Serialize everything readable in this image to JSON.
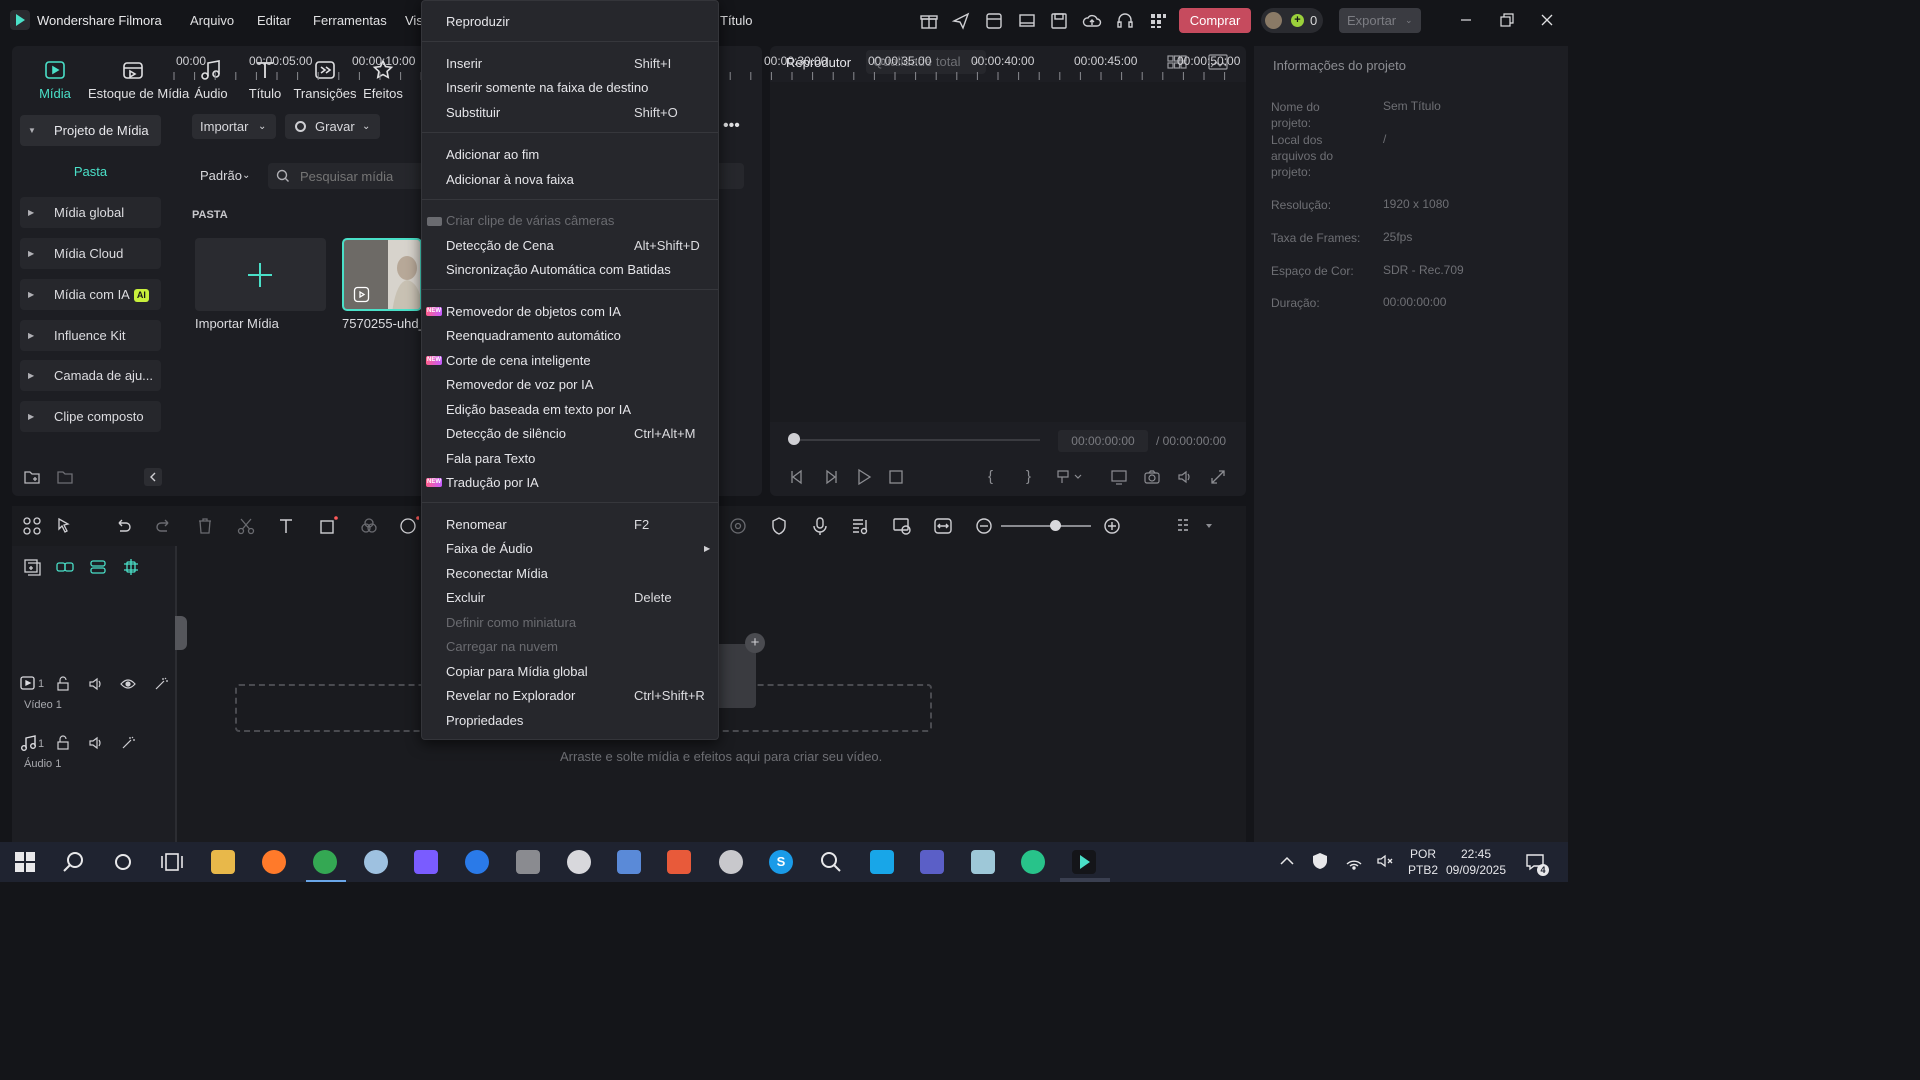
{
  "titlebar": {
    "app_name": "Wondershare Filmora",
    "menus": [
      "Arquivo",
      "Editar",
      "Ferramentas",
      "Vis"
    ],
    "project_title": "Título",
    "buy_label": "Comprar",
    "credits": "0",
    "export_label": "Exportar"
  },
  "toolbar_tabs": [
    {
      "label": "Mídia",
      "icon": "media-icon",
      "active": true
    },
    {
      "label": "Estoque de Mídia",
      "icon": "stock-media-icon"
    },
    {
      "label": "Áudio",
      "icon": "music-note-icon"
    },
    {
      "label": "Título",
      "icon": "title-t-icon"
    },
    {
      "label": "Transições",
      "icon": "transitions-icon"
    },
    {
      "label": "Efeitos",
      "icon": "effects-icon"
    }
  ],
  "left_nav": {
    "project_media": "Projeto de Mídia",
    "folder": "Pasta",
    "items": [
      "Mídia global",
      "Mídia Cloud",
      "Mídia com IA",
      "Influence Kit",
      "Camada de aju...",
      "Clipe composto"
    ],
    "ai_badge": "AI"
  },
  "media": {
    "import_button": "Importar",
    "record_button": "Gravar",
    "sort_dropdown": "Padrão",
    "search_placeholder": "Pesquisar mídia",
    "folder_label": "PASTA",
    "import_tile_label": "Importar Mídia",
    "clip_label": "7570255-uhd_"
  },
  "player": {
    "title": "Reprodutor",
    "quality": "Qualidade total",
    "time_current": "00:00:00:00",
    "time_total": "/ 00:00:00:00"
  },
  "project_info": {
    "title": "Informações do projeto",
    "rows": [
      {
        "key": "Nome do projeto:",
        "value": "Sem Título"
      },
      {
        "key": "Local dos arquivos do projeto:",
        "value": "/"
      },
      {
        "key": "Resolução:",
        "value": "1920 x 1080"
      },
      {
        "key": "Taxa de Frames:",
        "value": "25fps"
      },
      {
        "key": "Espaço de Cor:",
        "value": "SDR - Rec.709"
      },
      {
        "key": "Duração:",
        "value": "00:00:00:00"
      }
    ]
  },
  "timeline": {
    "ruler": [
      "00:00",
      "00:00:05:00",
      "00:00:10:00",
      "00:00:30:00",
      "00:00:35:00",
      "00:00:40:00",
      "00:00:45:00",
      "00:00:50:00"
    ],
    "video_track": "Vídeo 1",
    "audio_track": "Áudio 1",
    "track_num": "1",
    "drop_hint": "Arraste e solte mídia e efeitos aqui para criar seu vídeo."
  },
  "context_menu": {
    "items": [
      {
        "label": "Reproduzir",
        "shortcut": ""
      },
      {
        "label": "Inserir",
        "shortcut": "Shift+I"
      },
      {
        "label": "Inserir somente na faixa de destino",
        "shortcut": ""
      },
      {
        "label": "Substituir",
        "shortcut": "Shift+O"
      },
      {
        "label": "Adicionar ao fim",
        "shortcut": ""
      },
      {
        "label": "Adicionar à nova faixa",
        "shortcut": ""
      },
      {
        "label": "Criar clipe de várias câmeras",
        "shortcut": "",
        "disabled": true
      },
      {
        "label": "Detecção de Cena",
        "shortcut": "Alt+Shift+D"
      },
      {
        "label": "Sincronização Automática com Batidas",
        "shortcut": ""
      },
      {
        "label": "Removedor de objetos com IA",
        "shortcut": "",
        "new": true
      },
      {
        "label": "Reenquadramento automático",
        "shortcut": ""
      },
      {
        "label": "Corte de cena inteligente",
        "shortcut": "",
        "new": true
      },
      {
        "label": "Removedor de voz por IA",
        "shortcut": ""
      },
      {
        "label": "Edição baseada em texto por IA",
        "shortcut": ""
      },
      {
        "label": "Detecção de silêncio",
        "shortcut": "Ctrl+Alt+M"
      },
      {
        "label": "Fala para Texto",
        "shortcut": ""
      },
      {
        "label": "Tradução por IA",
        "shortcut": "",
        "new": true
      },
      {
        "label": "Renomear",
        "shortcut": "F2"
      },
      {
        "label": "Faixa de Áudio",
        "shortcut": "",
        "submenu": true
      },
      {
        "label": "Reconectar Mídia",
        "shortcut": ""
      },
      {
        "label": "Excluir",
        "shortcut": "Delete"
      },
      {
        "label": "Definir como miniatura",
        "shortcut": "",
        "disabled": true
      },
      {
        "label": "Carregar na nuvem",
        "shortcut": "",
        "disabled": true
      },
      {
        "label": "Copiar para Mídia global",
        "shortcut": ""
      },
      {
        "label": "Revelar no Explorador",
        "shortcut": "Ctrl+Shift+R"
      },
      {
        "label": "Propriedades",
        "shortcut": ""
      }
    ],
    "new_badge": "NEW"
  },
  "taskbar": {
    "lang": "POR",
    "layout": "PTB2",
    "time": "22:45",
    "date": "09/09/2025",
    "notifications": "4"
  },
  "colors": {
    "accent": "#4ae0c8",
    "buy": "#c64b5e",
    "panel": "#1d1e23",
    "menu": "#26272c"
  }
}
